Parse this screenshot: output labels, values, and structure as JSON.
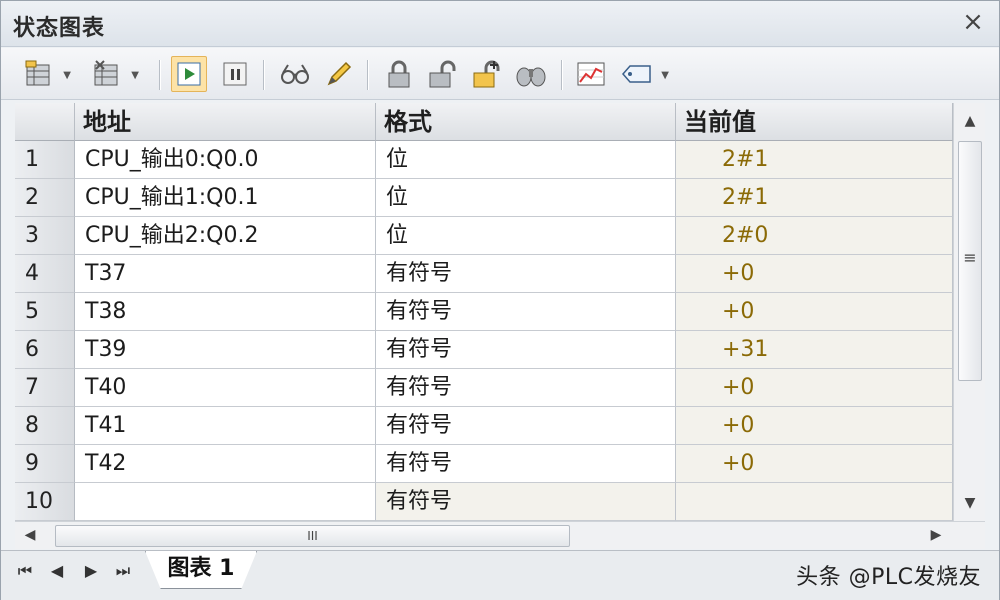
{
  "window": {
    "title": "状态图表",
    "close": "×"
  },
  "toolbar": {
    "buttons": [
      {
        "name": "insert-row-icon"
      },
      {
        "name": "delete-row-icon"
      },
      {
        "name": "run-status-icon",
        "active": true
      },
      {
        "name": "pause-icon"
      },
      {
        "name": "read-view-icon"
      },
      {
        "name": "write-pencil-icon"
      },
      {
        "name": "force-lock-icon"
      },
      {
        "name": "unforce-lock-icon"
      },
      {
        "name": "unforce-all-icon"
      },
      {
        "name": "read-all-forced-icon"
      },
      {
        "name": "trend-chart-icon"
      },
      {
        "name": "tag-icon"
      }
    ]
  },
  "table": {
    "headers": [
      "地址",
      "格式",
      "当前值"
    ],
    "rows": [
      {
        "n": "1",
        "address": "CPU_输出0:Q0.0",
        "format": "位",
        "value": "2#1"
      },
      {
        "n": "2",
        "address": "CPU_输出1:Q0.1",
        "format": "位",
        "value": "2#1"
      },
      {
        "n": "3",
        "address": "CPU_输出2:Q0.2",
        "format": "位",
        "value": "2#0"
      },
      {
        "n": "4",
        "address": "T37",
        "format": "有符号",
        "value": "+0"
      },
      {
        "n": "5",
        "address": "T38",
        "format": "有符号",
        "value": "+0"
      },
      {
        "n": "6",
        "address": "T39",
        "format": "有符号",
        "value": "+31"
      },
      {
        "n": "7",
        "address": "T40",
        "format": "有符号",
        "value": "+0"
      },
      {
        "n": "8",
        "address": "T41",
        "format": "有符号",
        "value": "+0"
      },
      {
        "n": "9",
        "address": "T42",
        "format": "有符号",
        "value": "+0"
      },
      {
        "n": "10",
        "address": "",
        "format": "有符号",
        "value": ""
      }
    ]
  },
  "scroll": {
    "thumb_grip": "III",
    "vthumb_grip": "≡"
  },
  "tabs": {
    "active": "图表 1"
  },
  "watermark": "头条 @PLC发烧友",
  "colors": {
    "value_text": "#8b6a06",
    "active_button": "#fde3a7"
  }
}
